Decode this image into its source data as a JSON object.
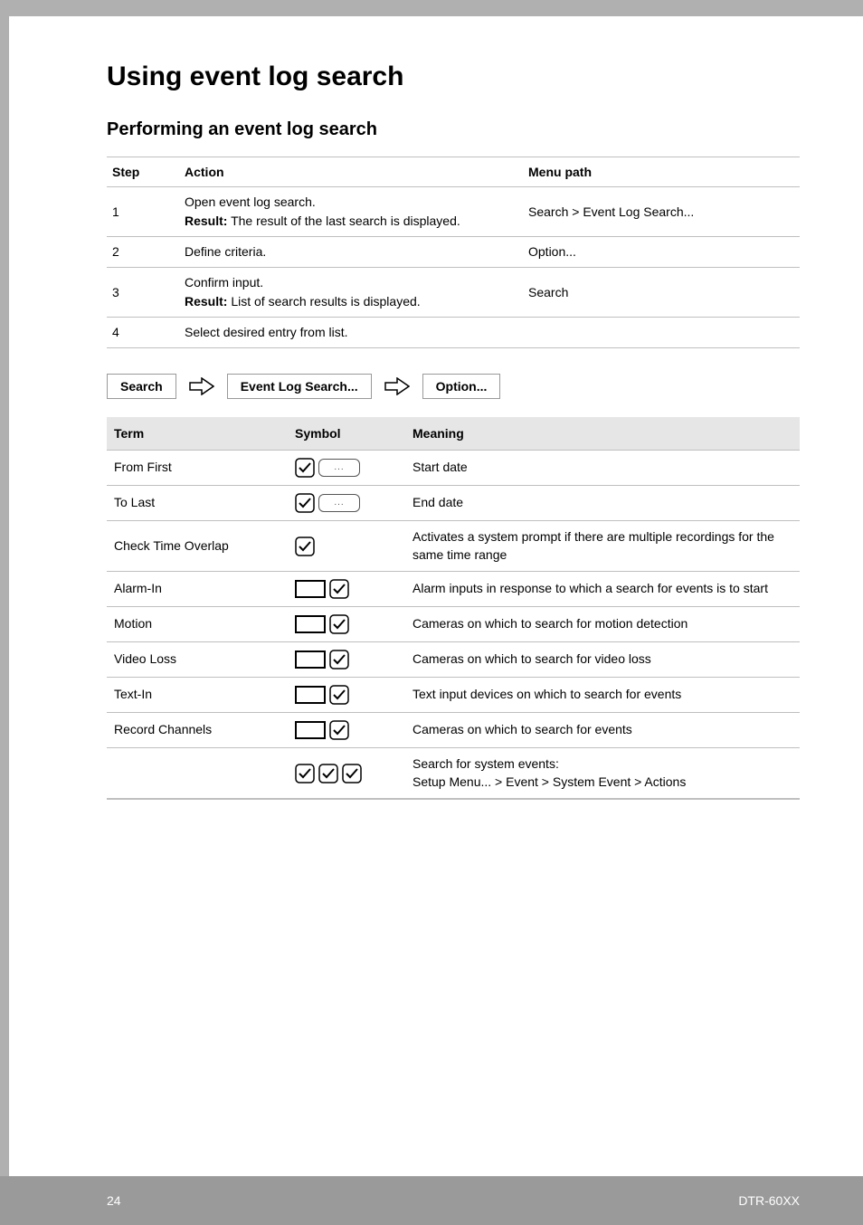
{
  "title": "Using event log search",
  "subtitle": "Performing an event log search",
  "steps": {
    "headers": {
      "step": "Step",
      "action": "Action",
      "menu": "Menu path"
    },
    "rows": [
      {
        "step": "1",
        "action_pre": "Open event log search.",
        "result_label": "Result:",
        "result_text": " The result of the last search is displayed.",
        "menu": "Search > Event Log Search..."
      },
      {
        "step": "2",
        "action_pre": "Define criteria.",
        "result_label": "",
        "result_text": "",
        "menu": "Option..."
      },
      {
        "step": "3",
        "action_pre": "Confirm input.",
        "result_label": "Result:",
        "result_text": " List of search results is displayed.",
        "menu": "Search"
      },
      {
        "step": "4",
        "action_pre": "Select desired entry from list.",
        "result_label": "",
        "result_text": "",
        "menu": ""
      }
    ]
  },
  "breadcrumb": {
    "a": "Search",
    "b": "Event Log Search...",
    "c": "Option..."
  },
  "terms": {
    "headers": {
      "term": "Term",
      "symbol": "Symbol",
      "meaning": "Meaning"
    },
    "rows": [
      {
        "term": "From First",
        "symbol": "check-dots",
        "meaning": "Start date"
      },
      {
        "term": "To Last",
        "symbol": "check-dots",
        "meaning": "End date"
      },
      {
        "term": "Check Time Overlap",
        "symbol": "check",
        "meaning": "Activates a system prompt if there are multiple recordings for the same time range"
      },
      {
        "term": "Alarm-In",
        "symbol": "box-check",
        "meaning": "Alarm inputs in response to which a search for events is to start"
      },
      {
        "term": "Motion",
        "symbol": "box-check",
        "meaning": "Cameras on which to search for motion detection"
      },
      {
        "term": "Video Loss",
        "symbol": "box-check",
        "meaning": "Cameras on which to search for video loss"
      },
      {
        "term": "Text-In",
        "symbol": "box-check",
        "meaning": "Text input devices on which to search for events"
      },
      {
        "term": "Record Channels",
        "symbol": "box-check",
        "meaning": "Cameras on which to search for events"
      },
      {
        "term": "",
        "symbol": "triple-check",
        "meaning1": "Search for system events:",
        "meaning2": "Setup Menu... > Event > System Event > Actions"
      }
    ]
  },
  "footer": {
    "page": "24",
    "model": "DTR-60XX"
  },
  "dots": "..."
}
